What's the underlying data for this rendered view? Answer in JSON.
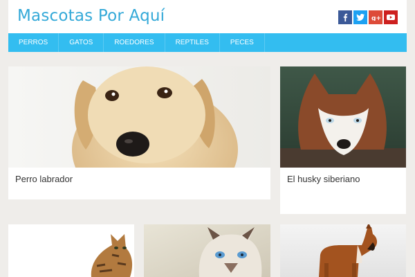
{
  "site": {
    "title": "Mascotas Por Aquí"
  },
  "social": [
    {
      "name": "facebook",
      "icon": "facebook-icon",
      "color": "#3b5998"
    },
    {
      "name": "twitter",
      "icon": "twitter-icon",
      "color": "#1da1f2"
    },
    {
      "name": "google-plus",
      "icon": "google-plus-icon",
      "color": "#dd4b39"
    },
    {
      "name": "youtube",
      "icon": "youtube-icon",
      "color": "#cd201f"
    }
  ],
  "nav": {
    "items": [
      {
        "label": "PERROS"
      },
      {
        "label": "GATOS"
      },
      {
        "label": "ROEDORES"
      },
      {
        "label": "REPTILES"
      },
      {
        "label": "PECES"
      }
    ]
  },
  "cards": [
    {
      "title": "Perro labrador",
      "image": "labrador-puppy-photo"
    },
    {
      "title": "El husky siberiano",
      "image": "siberian-husky-photo"
    },
    {
      "title": "",
      "image": "bengal-kitten-photo"
    },
    {
      "title": "",
      "image": "siamese-cat-photo"
    },
    {
      "title": "",
      "image": "boxer-dog-photo"
    }
  ],
  "colors": {
    "accent": "#34a9d8",
    "nav_bg": "#33bdf0",
    "page_bg": "#efedea"
  }
}
